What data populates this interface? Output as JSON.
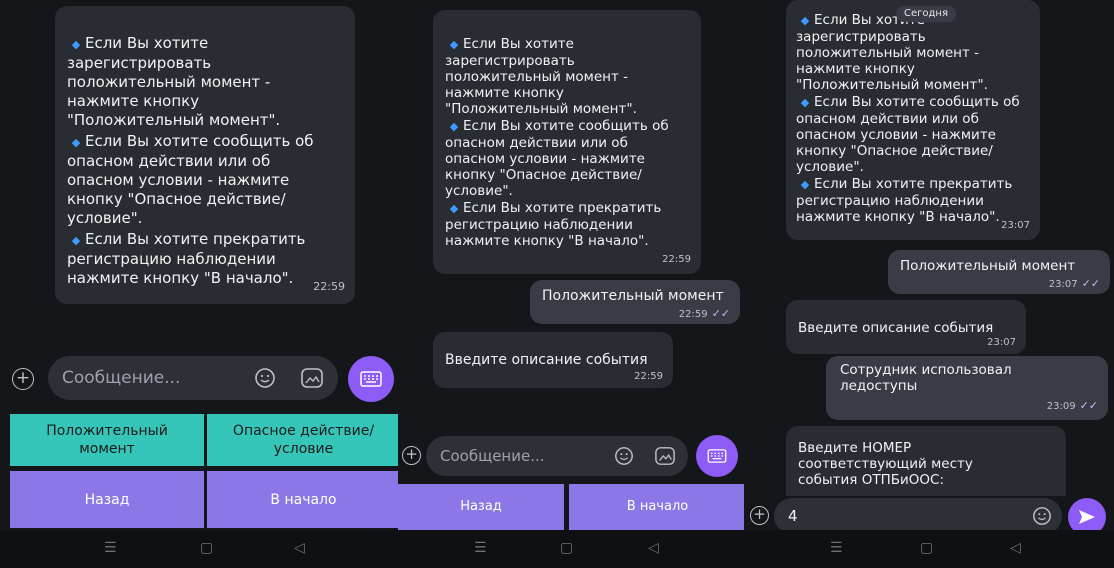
{
  "bot_instructions": {
    "line1": "Если Вы хотите\nзарегистрировать\nположительный момент -\nнажмите кнопку\n\"Положительный момент\".",
    "line2": "Если Вы хотите  сообщить об\nопасном действии или об\nопасном условии - нажмите\nкнопку \"Опасное действие/\nусловие\".",
    "line3": "Если Вы хотите прекратить\nрегистрацию наблюдении\nнажмите кнопку \"В начало\"."
  },
  "screen1": {
    "instructions_time": "22:59",
    "input_placeholder": "Сообщение...",
    "buttons": {
      "positive": "Положительный\nмомент",
      "dangerous": "Опасное действие/\nусловие",
      "back": "Назад",
      "home": "В начало"
    }
  },
  "screen2": {
    "instructions_time": "22:59",
    "user_message": "Положительный момент",
    "user_message_time": "22:59",
    "bot_prompt": "Введите описание события",
    "bot_prompt_time": "22:59",
    "input_placeholder": "Сообщение...",
    "buttons": {
      "back": "Назад",
      "home": "В начало"
    }
  },
  "screen3": {
    "date_badge": "Сегодня",
    "instructions_time": "23:07",
    "user_message": "Положительный момент",
    "user_message_time": "23:07",
    "bot_prompt": "Введите описание события",
    "bot_prompt_time": "23:07",
    "user_reply": "Сотрудник использовал\nледоступы",
    "user_reply_time": "23:09",
    "bot_prompt2": "Введите НОМЕР\nсоответствующий месту\nсобытия ОТПБиООС:",
    "input_value": "4"
  },
  "icons": {
    "bullet": "blue-diamond-icon",
    "add": "plus-circle-icon",
    "emoji": "emoji-icon",
    "sticker": "sticker-icon",
    "keyboard": "keyboard-icon",
    "send": "send-icon",
    "read": "double-check-icon"
  },
  "colors": {
    "background": "#15161a",
    "bubble": "#2a2c33",
    "accent": "#8d5cf6",
    "teal_button": "#36c6b9",
    "purple_button": "#8b78e6",
    "bullet": "#3f9bff"
  }
}
